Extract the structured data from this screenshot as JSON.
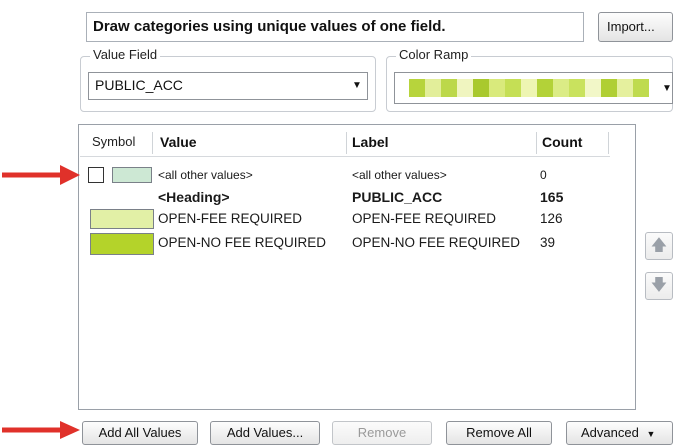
{
  "description": "Draw categories using unique values of one field.",
  "import_label": "Import...",
  "value_field": {
    "label": "Value Field",
    "selected": "PUBLIC_ACC"
  },
  "color_ramp": {
    "label": "Color Ramp",
    "colors": [
      "#b7d43c",
      "#e2ee9a",
      "#bcd84a",
      "#f0f5c0",
      "#a9c92e",
      "#d9ea7c",
      "#c5df55",
      "#eef5b2",
      "#b3d238",
      "#dbec86",
      "#c9e25e",
      "#f2f7c8",
      "#b0cf34",
      "#e5f09e",
      "#bfdb4e"
    ]
  },
  "table": {
    "headers": {
      "symbol": "Symbol",
      "value": "Value",
      "label": "Label",
      "count": "Count"
    },
    "rows": [
      {
        "value": "<all other values>",
        "label": "<all other values>",
        "count": "0",
        "symbol_color": "#cde8d4",
        "kind": "other"
      },
      {
        "value": "<Heading>",
        "label": "PUBLIC_ACC",
        "count": "165",
        "symbol_color": "",
        "kind": "heading"
      },
      {
        "value": "OPEN-FEE REQUIRED",
        "label": "OPEN-FEE REQUIRED",
        "count": "126",
        "symbol_color": "#e2f0a6",
        "kind": "item"
      },
      {
        "value": "OPEN-NO FEE REQUIRED",
        "label": "OPEN-NO FEE REQUIRED",
        "count": "39",
        "symbol_color": "#b4d32a",
        "kind": "item"
      }
    ]
  },
  "side_buttons": {
    "up_icon": "arrow-up-icon",
    "down_icon": "arrow-down-icon"
  },
  "buttons": {
    "add_all_values": "Add All Values",
    "add_values": "Add Values...",
    "remove": "Remove",
    "remove_all": "Remove All",
    "advanced": "Advanced"
  },
  "annotation_color": "#e0312a"
}
